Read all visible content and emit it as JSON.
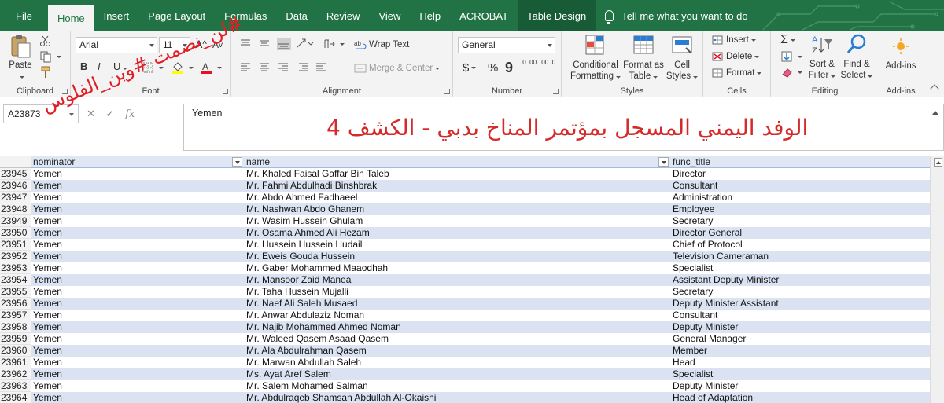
{
  "tabs": [
    "File",
    "Home",
    "Insert",
    "Page Layout",
    "Formulas",
    "Data",
    "Review",
    "View",
    "Help",
    "ACROBAT",
    "Table Design"
  ],
  "active_tab": "Home",
  "tell_me": "Tell me what you want to do",
  "ribbon": {
    "clipboard": {
      "paste": "Paste",
      "label": "Clipboard"
    },
    "font": {
      "name": "Arial",
      "size": "11",
      "label": "Font",
      "bold": "B",
      "italic": "I",
      "underline": "U",
      "grow": "A",
      "shrink": "A"
    },
    "alignment": {
      "wrap_text": "Wrap Text",
      "merge_center": "Merge & Center",
      "label": "Alignment"
    },
    "number": {
      "format": "General",
      "currency": "$",
      "percent": "%",
      "comma": "9",
      "inc_decimal": ".0 .00",
      "dec_decimal": ".00 .0",
      "label": "Number"
    },
    "styles": {
      "conditional": "Conditional",
      "formatting": "Formatting",
      "format_as": "Format as",
      "table": "Table",
      "cell": "Cell",
      "cell_styles": "Styles",
      "label": "Styles"
    },
    "cells": {
      "insert": "Insert",
      "delete": "Delete",
      "format": "Format",
      "label": "Cells"
    },
    "editing": {
      "sigma": "Σ",
      "sort_filter_1": "Sort &",
      "sort_filter_2": "Filter",
      "find_select_1": "Find &",
      "find_select_2": "Select",
      "label": "Editing"
    },
    "addins": {
      "button": "Add-ins",
      "label": "Add-ins"
    }
  },
  "name_box": "A23873",
  "formula_value": "Yemen",
  "overlay_title": "الوفد اليمني المسجل بمؤتمر المناخ بدبي  -  الكشف 4",
  "hashtag": "#لن_نصمت #وين_الفلوس",
  "columns": [
    "nominator",
    "name",
    "func_title"
  ],
  "rows": [
    {
      "num": "23945",
      "nominator": "Yemen",
      "name": "Mr. Khaled Faisal Gaffar Bin Taleb",
      "func": "Director"
    },
    {
      "num": "23946",
      "nominator": "Yemen",
      "name": "Mr. Fahmi Abdulhadi Binshbrak",
      "func": "Consultant"
    },
    {
      "num": "23947",
      "nominator": "Yemen",
      "name": "Mr. Abdo Ahmed Fadhaeel",
      "func": "Administration"
    },
    {
      "num": "23948",
      "nominator": "Yemen",
      "name": "Mr. Nashwan Abdo Ghanem",
      "func": "Employee"
    },
    {
      "num": "23949",
      "nominator": "Yemen",
      "name": "Mr. Wasim Hussein Ghulam",
      "func": "Secretary"
    },
    {
      "num": "23950",
      "nominator": "Yemen",
      "name": "Mr. Osama Ahmed Ali Hezam",
      "func": "Director General"
    },
    {
      "num": "23951",
      "nominator": "Yemen",
      "name": "Mr. Hussein Hussein Hudail",
      "func": "Chief of Protocol"
    },
    {
      "num": "23952",
      "nominator": "Yemen",
      "name": "Mr. Eweis Gouda Hussein",
      "func": "Television Cameraman"
    },
    {
      "num": "23953",
      "nominator": "Yemen",
      "name": "Mr. Gaber Mohammed Maaodhah",
      "func": "Specialist"
    },
    {
      "num": "23954",
      "nominator": "Yemen",
      "name": "Mr. Mansoor Zaid Manea",
      "func": "Assistant Deputy Minister"
    },
    {
      "num": "23955",
      "nominator": "Yemen",
      "name": "Mr. Taha Hussein Mujalli",
      "func": "Secretary"
    },
    {
      "num": "23956",
      "nominator": "Yemen",
      "name": "Mr. Naef Ali Saleh Musaed",
      "func": "Deputy Minister Assistant"
    },
    {
      "num": "23957",
      "nominator": "Yemen",
      "name": "Mr. Anwar Abdulaziz Noman",
      "func": "Consultant"
    },
    {
      "num": "23958",
      "nominator": "Yemen",
      "name": "Mr. Najib Mohammed Ahmed Noman",
      "func": "Deputy Minister"
    },
    {
      "num": "23959",
      "nominator": "Yemen",
      "name": "Mr. Waleed Qasem Asaad Qasem",
      "func": "General Manager"
    },
    {
      "num": "23960",
      "nominator": "Yemen",
      "name": "Mr. Ala Abdulrahman Qasem",
      "func": "Member"
    },
    {
      "num": "23961",
      "nominator": "Yemen",
      "name": "Mr. Marwan Abdullah Saleh",
      "func": "Head"
    },
    {
      "num": "23962",
      "nominator": "Yemen",
      "name": "Ms. Ayat Aref Salem",
      "func": "Specialist"
    },
    {
      "num": "23963",
      "nominator": "Yemen",
      "name": "Mr. Salem Mohamed Salman",
      "func": "Deputy Minister"
    },
    {
      "num": "23964",
      "nominator": "Yemen",
      "name": "Mr. Abdulraqeb Shamsan Abdullah Al-Okaishi",
      "func": "Head of Adaptation"
    }
  ]
}
